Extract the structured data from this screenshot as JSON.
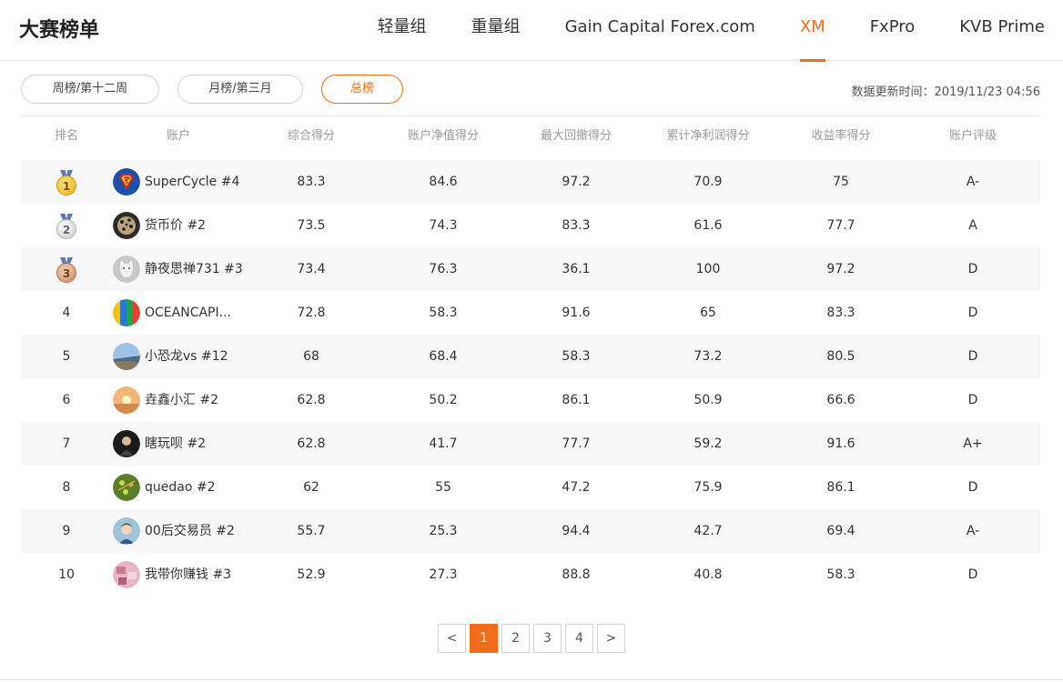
{
  "page": {
    "title": "大赛榜单",
    "tabs": [
      {
        "label": "轻量组",
        "active": false
      },
      {
        "label": "重量组",
        "active": false
      },
      {
        "label": "Gain Capital Forex.com",
        "active": false
      },
      {
        "label": "XM",
        "active": true
      },
      {
        "label": "FxPro",
        "active": false
      },
      {
        "label": "KVB Prime",
        "active": false
      }
    ]
  },
  "filters": [
    {
      "label": "周榜/第十二周",
      "active": false
    },
    {
      "label": "月榜/第三月",
      "active": false
    },
    {
      "label": "总榜",
      "active": true
    }
  ],
  "update_text": "数据更新时间：2019/11/23 04:56",
  "table": {
    "headers": [
      "排名",
      "账户",
      "综合得分",
      "账户净值得分",
      "最大回撤得分",
      "累计净利润得分",
      "收益率得分",
      "账户评级"
    ],
    "rows": [
      {
        "rank": "1",
        "medal": "gold",
        "account": "SuperCycle #4",
        "avatar_icon": "superman-logo-icon",
        "total": "83.3",
        "equity": "84.6",
        "drawdown": "97.2",
        "profit": "70.9",
        "return": "75",
        "rating": "A-"
      },
      {
        "rank": "2",
        "medal": "silver",
        "account": "货币价 #2",
        "avatar_icon": "leopard-avatar-icon",
        "total": "73.5",
        "equity": "74.3",
        "drawdown": "83.3",
        "profit": "61.6",
        "return": "77.7",
        "rating": "A"
      },
      {
        "rank": "3",
        "medal": "bronze",
        "account": "静夜思禅731 #3",
        "avatar_icon": "white-cat-avatar-icon",
        "total": "73.4",
        "equity": "76.3",
        "drawdown": "36.1",
        "profit": "100",
        "return": "97.2",
        "rating": "D"
      },
      {
        "rank": "4",
        "medal": "",
        "account": "OCEANCAPI...",
        "avatar_icon": "colorful-stripes-avatar-icon",
        "total": "72.8",
        "equity": "58.3",
        "drawdown": "91.6",
        "profit": "65",
        "return": "83.3",
        "rating": "D"
      },
      {
        "rank": "5",
        "medal": "",
        "account": "小恐龙vs #12",
        "avatar_icon": "seaside-avatar-icon",
        "total": "68",
        "equity": "68.4",
        "drawdown": "58.3",
        "profit": "73.2",
        "return": "80.5",
        "rating": "D"
      },
      {
        "rank": "6",
        "medal": "",
        "account": "垚鑫小汇 #2",
        "avatar_icon": "sunset-avatar-icon",
        "total": "62.8",
        "equity": "50.2",
        "drawdown": "86.1",
        "profit": "50.9",
        "return": "66.6",
        "rating": "D"
      },
      {
        "rank": "7",
        "medal": "",
        "account": "瞎玩呗 #2",
        "avatar_icon": "dark-portrait-avatar-icon",
        "total": "62.8",
        "equity": "41.7",
        "drawdown": "77.7",
        "profit": "59.2",
        "return": "91.6",
        "rating": "A+"
      },
      {
        "rank": "8",
        "medal": "",
        "account": "quedao #2",
        "avatar_icon": "green-pattern-avatar-icon",
        "total": "62",
        "equity": "55",
        "drawdown": "47.2",
        "profit": "75.9",
        "return": "86.1",
        "rating": "D"
      },
      {
        "rank": "9",
        "medal": "",
        "account": "00后交易员 #2",
        "avatar_icon": "boy-avatar-icon",
        "total": "55.7",
        "equity": "25.3",
        "drawdown": "94.4",
        "profit": "42.7",
        "return": "69.4",
        "rating": "A-"
      },
      {
        "rank": "10",
        "medal": "",
        "account": "我带你赚钱 #3",
        "avatar_icon": "pink-avatar-icon",
        "total": "52.9",
        "equity": "27.3",
        "drawdown": "88.8",
        "profit": "40.8",
        "return": "58.3",
        "rating": "D"
      }
    ]
  },
  "pagination": {
    "prev": "<",
    "pages": [
      "1",
      "2",
      "3",
      "4"
    ],
    "current": "1",
    "next": ">"
  },
  "colors": {
    "accent": "#f06c1a",
    "row_stripe": "#f7f7f7",
    "header_text": "#999999"
  }
}
